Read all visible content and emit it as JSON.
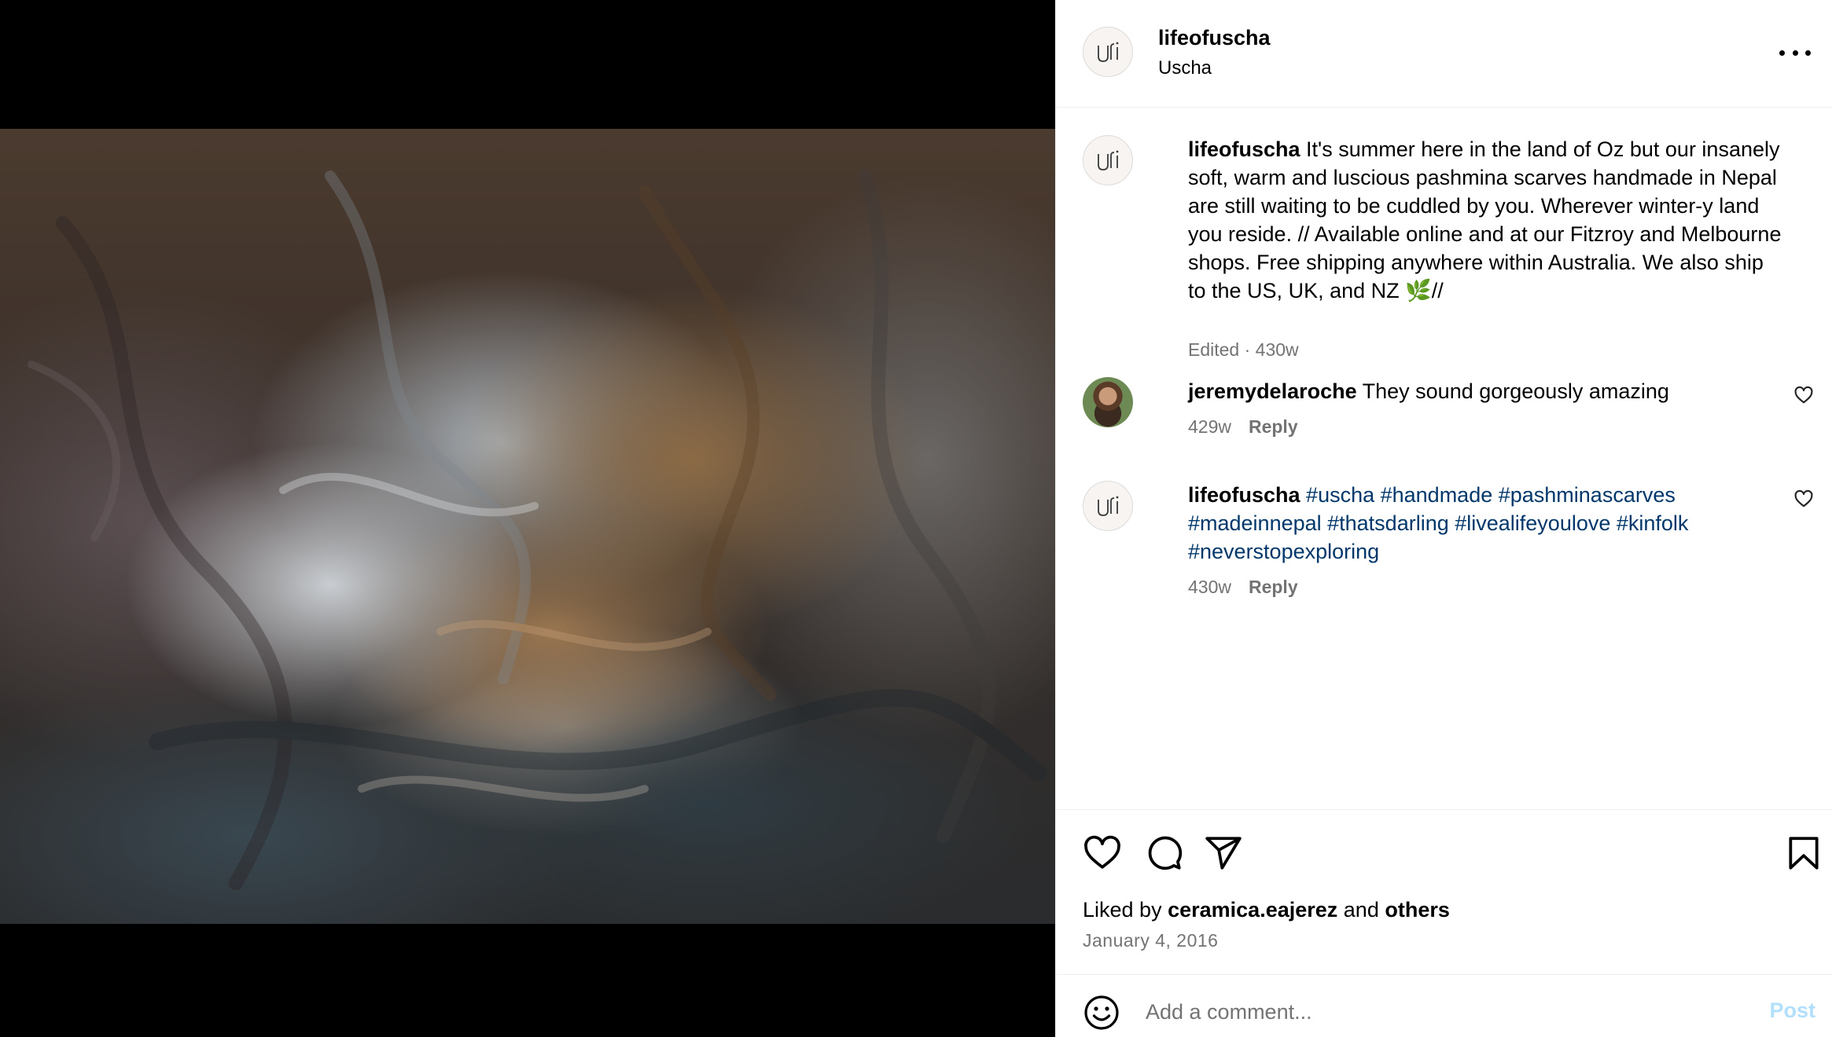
{
  "post": {
    "username": "lifeofuscha",
    "full_name": "Uscha",
    "photo_alt": "Pile of pashmina scarves in grey, brown, taupe and charcoal on a wooden floor"
  },
  "caption": {
    "username": "lifeofuscha",
    "text": "It's summer here in the land of Oz but our insanely soft, warm and luscious pashmina scarves handmade in Nepal are still waiting to be cuddled by you. Wherever winter-y land you reside. // Available online and at our Fitzroy and Melbourne shops. Free shipping anywhere within Australia. We also ship to the US, UK, and NZ 🌿//",
    "meta": "Edited · 430w"
  },
  "comments": [
    {
      "username": "jeremydelaroche",
      "text": "They sound gorgeously amazing",
      "time": "429w",
      "reply_label": "Reply"
    },
    {
      "username": "lifeofuscha",
      "tags": "#uscha #handmade #pashminascarves #madeinnepal #thatsdarling #livealifeyoulove #kinfolk #neverstopexploring",
      "time": "430w",
      "reply_label": "Reply"
    }
  ],
  "likes": {
    "prefix": "Liked by",
    "user": "ceramica.eajerez",
    "and": "and",
    "others": "others"
  },
  "date": "January 4, 2016",
  "add_comment": {
    "placeholder": "Add a comment...",
    "post_label": "Post"
  },
  "colors": {
    "hashtag": "#00376b",
    "muted": "#737373",
    "post_disabled": "#b2dffc"
  },
  "icons": [
    "more-options-icon",
    "like-icon",
    "comment-icon",
    "share-icon",
    "save-icon",
    "emoji-icon",
    "comment-like-icon"
  ]
}
